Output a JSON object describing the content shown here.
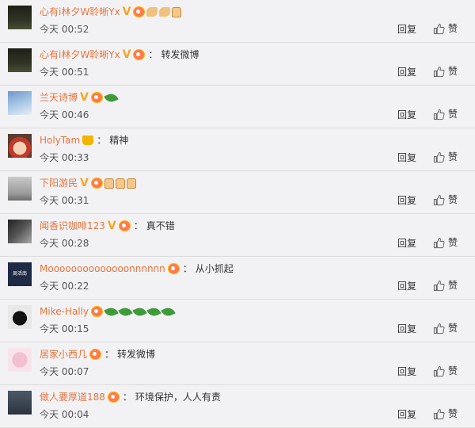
{
  "comments": [
    {
      "name": "心有i林夕W聆晰Yx",
      "vip": "V",
      "crown": false,
      "member": true,
      "colon": "",
      "text": "",
      "emojis": [
        "arm",
        "arm",
        "thumb"
      ],
      "time": "今天 00:52",
      "avatar": "night"
    },
    {
      "name": "心有i林夕W聆晰Yx",
      "vip": "V",
      "crown": false,
      "member": true,
      "colon": "：",
      "text": "转发微博",
      "emojis": [],
      "time": "今天 00:51",
      "avatar": "night"
    },
    {
      "name": "兰天诗博",
      "vip": "V",
      "crown": false,
      "member": true,
      "colon": "",
      "text": "",
      "emojis": [
        "leaf"
      ],
      "time": "今天 00:46",
      "avatar": "sky"
    },
    {
      "name": "HolyTam",
      "vip": "",
      "crown": true,
      "member": false,
      "colon": "：",
      "text": "精神",
      "emojis": [],
      "time": "今天 00:33",
      "avatar": "cartoon"
    },
    {
      "name": "下阳游民",
      "vip": "V",
      "crown": false,
      "member": true,
      "colon": "",
      "text": "",
      "emojis": [
        "thumb",
        "thumb",
        "thumb"
      ],
      "time": "今天 00:31",
      "avatar": "tree"
    },
    {
      "name": "闻香识咖啡123",
      "vip": "V",
      "crown": false,
      "member": true,
      "colon": "：",
      "text": "真不错",
      "emojis": [],
      "time": "今天 00:28",
      "avatar": "dark"
    },
    {
      "name": "Moooooooooooooonnnnnn",
      "vip": "",
      "crown": false,
      "member": true,
      "colon": "：",
      "text": "从小抓起",
      "emojis": [],
      "time": "今天 00:22",
      "avatar": "navy"
    },
    {
      "name": "Mike-Hally",
      "vip": "",
      "crown": false,
      "member": true,
      "colon": "",
      "text": "",
      "emojis": [
        "leaf",
        "leaf",
        "leaf",
        "leaf",
        "leaf"
      ],
      "time": "今天 00:15",
      "avatar": "helmet"
    },
    {
      "name": "居家小西几",
      "vip": "",
      "crown": false,
      "member": true,
      "colon": "：",
      "text": "转发微博",
      "emojis": [],
      "time": "今天 00:07",
      "avatar": "bird"
    },
    {
      "name": "做人要厚道188",
      "vip": "",
      "crown": false,
      "member": true,
      "colon": "：",
      "text": "环境保护，人人有责",
      "emojis": [],
      "time": "今天 00:04",
      "avatar": "person"
    }
  ],
  "actions": {
    "reply": "回复",
    "like": "赞"
  },
  "avatar_text": {
    "navy": "周活南"
  },
  "colors": {
    "name": "#e8743b",
    "vip": "#f5a623",
    "background": "#f2f2f5",
    "divider": "#dcdcdc"
  }
}
